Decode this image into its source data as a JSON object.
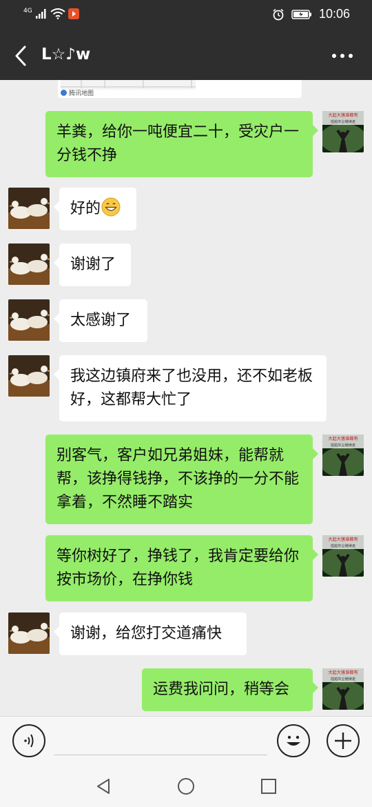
{
  "status_bar": {
    "network": "4G",
    "time": "10:06",
    "icons": [
      "signal-icon",
      "wifi-icon",
      "app-notification-icon",
      "alarm-icon",
      "battery-icon"
    ]
  },
  "title_bar": {
    "title": "L☆♪w",
    "back_icon": "back-arrow-icon",
    "more_icon": "more-options-icon"
  },
  "map_preview": {
    "logo_text": "腾讯地图"
  },
  "sent_avatar_text": [
    "大起大落谁都有",
    "拍拍灰尘继续走"
  ],
  "messages": [
    {
      "side": "out",
      "text": "羊粪，给你一吨便宜二十，受灾户一分钱不挣"
    },
    {
      "side": "in",
      "text": "好的",
      "emoji": "grinning-face"
    },
    {
      "side": "in",
      "text": "谢谢了"
    },
    {
      "side": "in",
      "text": "太感谢了"
    },
    {
      "side": "in",
      "text": "我这边镇府来了也没用，还不如老板好，这都帮大忙了"
    },
    {
      "side": "out",
      "text": "别客气，客户如兄弟姐妹，能帮就帮，该挣得钱挣，不该挣的一分不能拿着，不然睡不踏实"
    },
    {
      "side": "out",
      "text": " 等你树好了，挣钱了，我肯定要给你按市场价，在挣你钱"
    },
    {
      "side": "in",
      "text": "谢谢，给您打交道痛快"
    },
    {
      "side": "out",
      "text": "运费我问问，稍等会"
    }
  ],
  "input_bar": {
    "placeholder": "",
    "value": "",
    "icons": [
      "voice-icon",
      "emoji-icon",
      "plus-icon"
    ]
  },
  "nav_bar": {
    "icons": [
      "nav-back-icon",
      "nav-home-icon",
      "nav-recents-icon"
    ]
  },
  "colors": {
    "bar_dark": "#2e2e2e",
    "chat_bg": "#ededed",
    "bubble_out": "#95ec69",
    "bubble_in": "#ffffff"
  }
}
